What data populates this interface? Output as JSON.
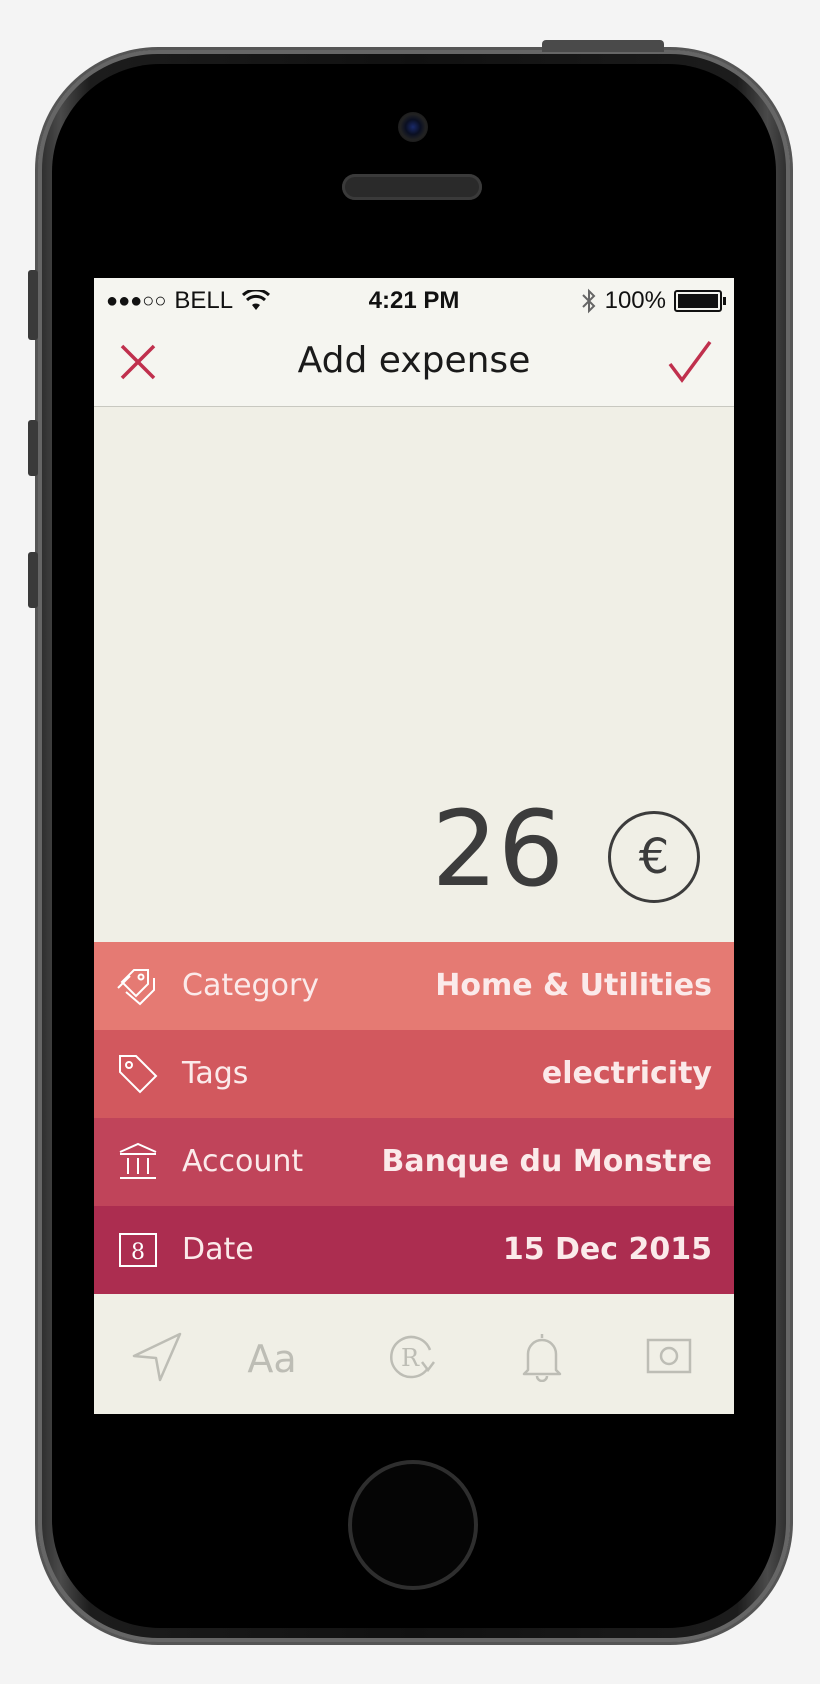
{
  "status_bar": {
    "signal": "●●●○○",
    "carrier": "BELL",
    "time": "4:21 PM",
    "battery": "100%"
  },
  "nav": {
    "title": "Add expense"
  },
  "amount": {
    "value": "26",
    "currency_symbol": "€"
  },
  "rows": [
    {
      "label": "Category",
      "value": "Home & Utilities",
      "color": "#e57a73",
      "icon": "tags-icon"
    },
    {
      "label": "Tags",
      "value": "electricity",
      "color": "#d2585e",
      "icon": "tag-icon"
    },
    {
      "label": "Account",
      "value": "Banque du Monstre",
      "color": "#c0445a",
      "icon": "bank-icon"
    },
    {
      "label": "Date",
      "value": "15 Dec 2015",
      "color": "#ac2d50",
      "icon": "calendar-icon",
      "icon_text": "8"
    }
  ],
  "toolbar": {
    "icons": [
      "location-icon",
      "text-icon",
      "recurring-icon",
      "bell-icon",
      "camera-icon"
    ],
    "text_icon_label": "Aa",
    "recurring_icon_label": "R"
  },
  "colors": {
    "accent": "#c0304d",
    "background": "#f0efe6",
    "toolbar_icon": "#bdbdb5"
  }
}
